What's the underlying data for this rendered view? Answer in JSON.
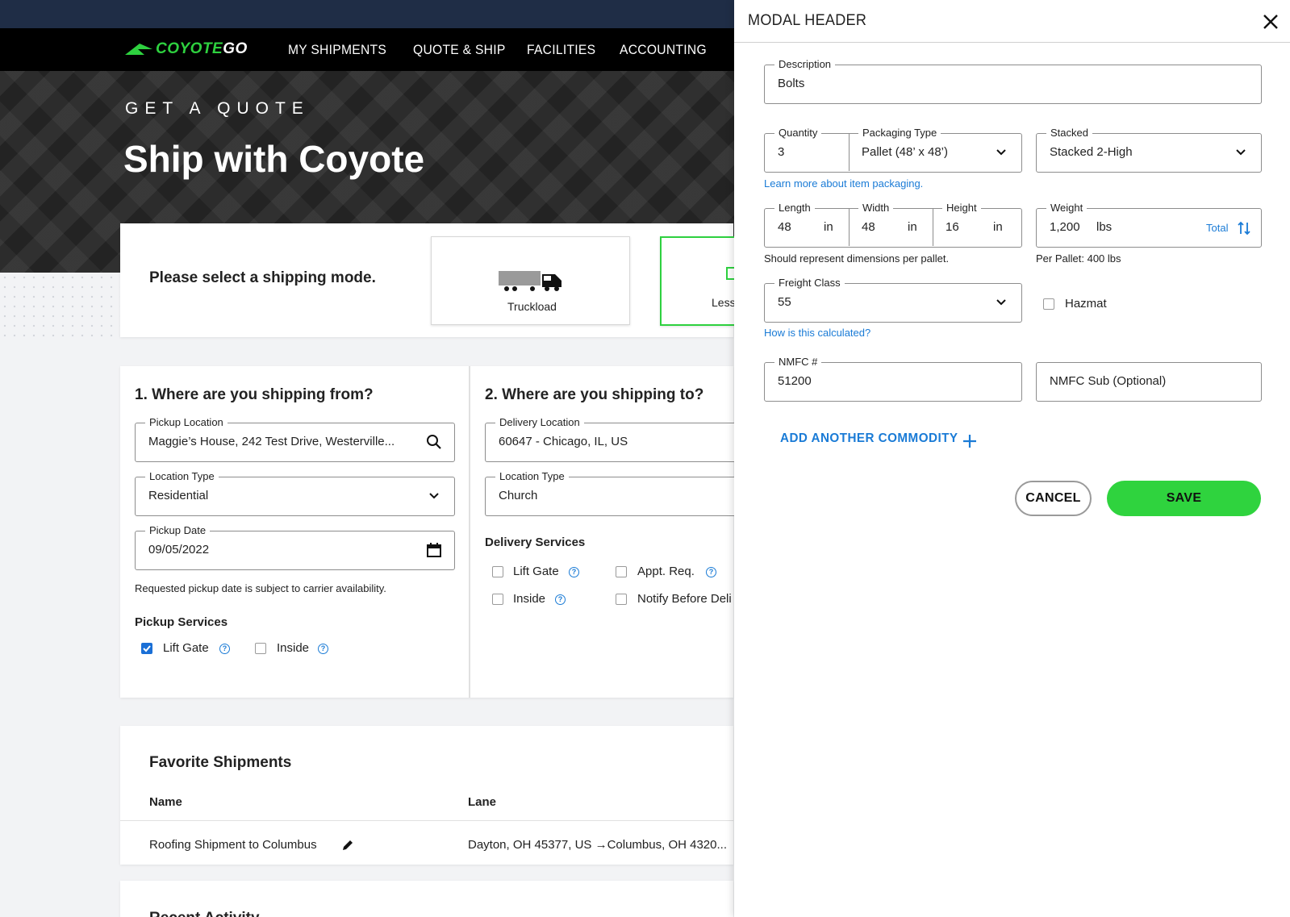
{
  "app": {
    "logo_brand": "COYOTE",
    "logo_go": "GO",
    "nav": [
      "MY SHIPMENTS",
      "QUOTE & SHIP",
      "FACILITIES",
      "ACCOUNTING"
    ]
  },
  "hero": {
    "kicker": "GET A QUOTE",
    "title": "Ship with Coyote"
  },
  "mode": {
    "prompt": "Please select a shipping mode.",
    "options": [
      {
        "label": "Truckload",
        "selected": false
      },
      {
        "label": "Less",
        "selected": true
      }
    ]
  },
  "from": {
    "title": "1. Where are you shipping from?",
    "pickup_location_label": "Pickup Location",
    "pickup_location_value": "Maggie’s House, 242 Test Drive, Westerville...",
    "location_type_label": "Location Type",
    "location_type_value": "Residential",
    "pickup_date_label": "Pickup Date",
    "pickup_date_value": "09/05/2022",
    "date_hint": "Requested pickup date is subject to carrier availability.",
    "services_title": "Pickup Services",
    "services": [
      {
        "label": "Lift Gate",
        "checked": true
      },
      {
        "label": "Inside",
        "checked": false
      }
    ]
  },
  "to": {
    "title": "2. Where are you shipping to?",
    "delivery_location_label": "Delivery Location",
    "delivery_location_value": "60647 - Chicago, IL, US",
    "location_type_label": "Location Type",
    "location_type_value": "Church",
    "services_title": "Delivery Services",
    "services": [
      {
        "label": "Lift Gate",
        "checked": false
      },
      {
        "label": "Appt. Req.",
        "checked": false
      },
      {
        "label": "Inside",
        "checked": false
      },
      {
        "label": "Notify Before Deli",
        "checked": false
      }
    ]
  },
  "favorites": {
    "title": "Favorite Shipments",
    "columns": [
      "Name",
      "Lane"
    ],
    "rows": [
      {
        "name": "Roofing Shipment to Columbus",
        "lane": "Dayton, OH 45377, US →Columbus, OH 4320..."
      }
    ]
  },
  "recent": {
    "title": "Recent Activity"
  },
  "modal": {
    "title": "MODAL HEADER",
    "description_label": "Description",
    "description_value": "Bolts",
    "quantity_label": "Quantity",
    "quantity_value": "3",
    "packaging_label": "Packaging Type",
    "packaging_value": "Pallet (48’ x 48’)",
    "stacked_label": "Stacked",
    "stacked_value": "Stacked 2-High",
    "packaging_link": "Learn more about item packaging.",
    "length_label": "Length",
    "length_value": "48",
    "width_label": "Width",
    "width_value": "48",
    "height_label": "Height",
    "height_value": "16",
    "dim_unit": "in",
    "weight_label": "Weight",
    "weight_value": "1,200",
    "weight_unit": "lbs",
    "weight_toggle": "Total",
    "dim_hint": "Should represent dimensions per pallet.",
    "weight_hint": "Per Pallet: 400 lbs",
    "freight_class_label": "Freight Class",
    "freight_class_value": "55",
    "hazmat_label": "Hazmat",
    "freight_link": "How is this calculated?",
    "nmfc_label": "NMFC #",
    "nmfc_value": "51200",
    "nmfc_sub_placeholder": "NMFC Sub (Optional)",
    "add_commodity": "ADD ANOTHER COMMODITY",
    "cancel_label": "CANCEL",
    "save_label": "SAVE"
  },
  "colors": {
    "brand_green": "#2ed13f",
    "link_blue": "#1a7bd6",
    "topbar_navy": "#1f2d46"
  },
  "icons": [
    "coyote-logo-icon",
    "search-icon",
    "chevron-down-icon",
    "calendar-icon",
    "help-icon",
    "edit-pencil-icon",
    "truck-icon",
    "close-icon",
    "sort-toggle-icon",
    "plus-icon"
  ]
}
